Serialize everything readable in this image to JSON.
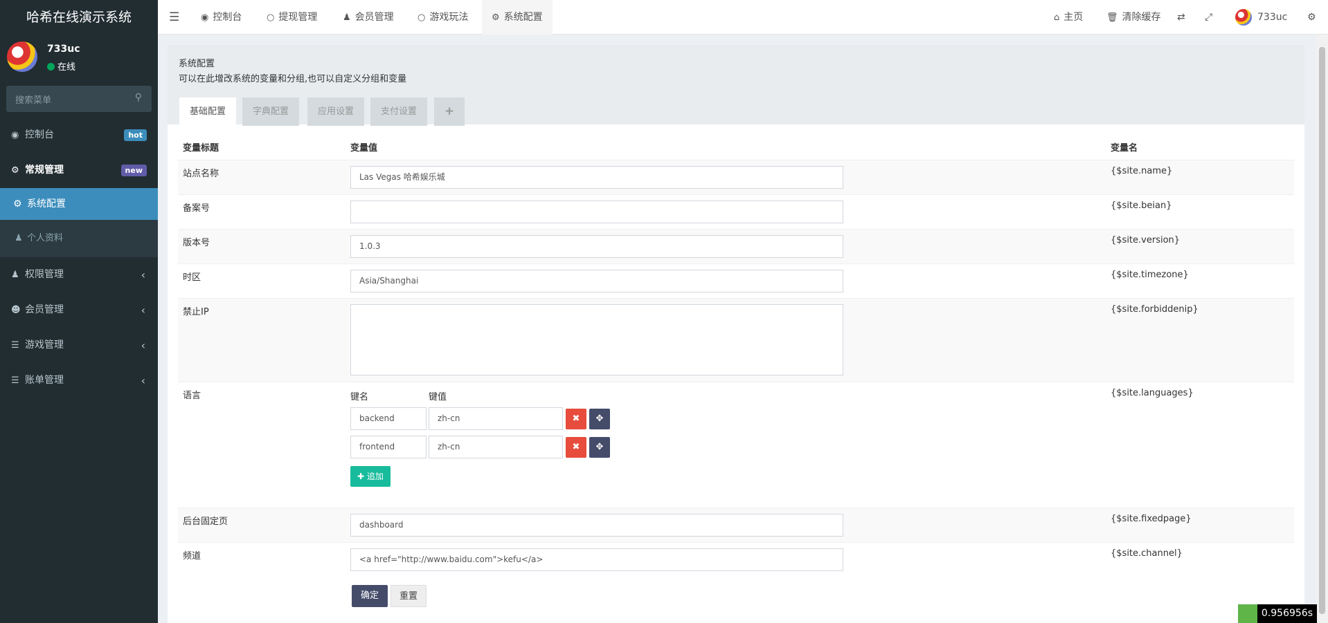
{
  "app": {
    "title": "哈希在线演示系统"
  },
  "user": {
    "name": "733uc",
    "status": "在线"
  },
  "sidebar": {
    "search_placeholder": "搜索菜单",
    "items": [
      {
        "label": "控制台",
        "badge": "hot",
        "badge_color": "#3c8dbc"
      },
      {
        "label": "常规管理",
        "badge": "new",
        "badge_color": "#605ca8"
      },
      {
        "label": "系统配置"
      },
      {
        "label": "个人资料"
      },
      {
        "label": "权限管理"
      },
      {
        "label": "会员管理"
      },
      {
        "label": "游戏管理"
      },
      {
        "label": "账单管理"
      }
    ]
  },
  "topbar": {
    "tabs": [
      "控制台",
      "提现管理",
      "会员管理",
      "游戏玩法",
      "系统配置"
    ],
    "home": "主页",
    "clear_cache": "清除缓存",
    "user": "733uc"
  },
  "page": {
    "title": "系统配置",
    "description": "可以在此增改系统的变量和分组,也可以自定义分组和变量",
    "tabs": [
      "基础配置",
      "字典配置",
      "应用设置",
      "支付设置",
      "+"
    ]
  },
  "table": {
    "headers": [
      "变量标题",
      "变量值",
      "变量名"
    ],
    "rows": [
      {
        "title": "站点名称",
        "value": "Las Vegas 哈希娱乐城",
        "name": "{$site.name}"
      },
      {
        "title": "备案号",
        "value": "",
        "name": "{$site.beian}"
      },
      {
        "title": "版本号",
        "value": "1.0.3",
        "name": "{$site.version}"
      },
      {
        "title": "时区",
        "value": "Asia/Shanghai",
        "name": "{$site.timezone}"
      },
      {
        "title": "禁止IP",
        "value": "",
        "name": "{$site.forbiddenip}"
      },
      {
        "title": "语言",
        "name": "{$site.languages}"
      },
      {
        "title": "后台固定页",
        "value": "dashboard",
        "name": "{$site.fixedpage}"
      },
      {
        "title": "频道",
        "value": "<a href=\"http://www.baidu.com\">kefu</a>",
        "name": "{$site.channel}"
      }
    ],
    "languages": {
      "key_header": "键名",
      "value_header": "键值",
      "pairs": [
        {
          "key": "backend",
          "value": "zh-cn"
        },
        {
          "key": "frontend",
          "value": "zh-cn"
        }
      ],
      "add_label": "追加"
    }
  },
  "buttons": {
    "submit": "确定",
    "reset": "重置"
  },
  "timer": "0.956956s"
}
